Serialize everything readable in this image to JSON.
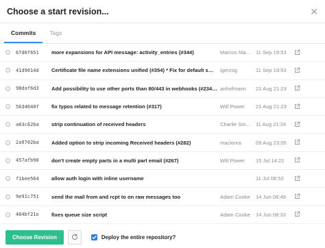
{
  "dialog": {
    "title": "Choose a start revision...",
    "close_glyph": "✕"
  },
  "tabs": [
    {
      "label": "Commits",
      "active": true
    },
    {
      "label": "Tags",
      "active": false
    }
  ],
  "commits": [
    {
      "sha": "67d0f651",
      "message": "more expansions for API message: activity_entries (#344)",
      "author": "Marcos Ma...",
      "date": "11 Sep 19:53"
    },
    {
      "sha": "41d9014d",
      "message": "Certificate file name extensions unified (#354) * Fix for default smtp certifi...",
      "author": "igerzog",
      "date": "11 Sep 19:53"
    },
    {
      "sha": "98daf6d3",
      "message": "Add possibility to use other ports than 80/443 in webhooks (#234) * Adde...",
      "author": "anhofmann",
      "date": "21 Aug 21:23"
    },
    {
      "sha": "5634640f",
      "message": "fix typos related to message retention (#317)",
      "author": "Will Power",
      "date": "21 Aug 21:23"
    },
    {
      "sha": "a63c62ba",
      "message": "strip continuation of received headers",
      "author": "Charlie Sm...",
      "date": "11 Aug 21:24"
    },
    {
      "sha": "2a9702ba",
      "message": "Added option to strip incoming Received headers (#282)",
      "author": "mackinra",
      "date": "09 Aug 23:05"
    },
    {
      "sha": "457afb90",
      "message": "don't create empty parts in a multi part email (#267)",
      "author": "Will Power",
      "date": "15 Jul 14:22"
    },
    {
      "sha": "f1bee564",
      "message": "allow auth login with inline username",
      "author": "",
      "date": "11 Jul 08:52"
    },
    {
      "sha": "9e91c751",
      "message": "send the mail from and rcpt to on raw messages too",
      "author": "Adam Cooke",
      "date": "14 Jun 08:49"
    },
    {
      "sha": "464bf21e",
      "message": "fixes queue size script",
      "author": "Adam Cooke",
      "date": "14 Jun 08:33"
    }
  ],
  "footer": {
    "choose_label": "Choose Revision",
    "deploy_label": "Deploy the entire repository?",
    "deploy_checked": true
  },
  "icons": {
    "external_link": "external-link-icon",
    "refresh": "refresh-icon",
    "check": "check-icon"
  },
  "colors": {
    "primary_button": "#2fbf8c",
    "tab_active": "#3a8be8",
    "checkbox": "#2f7de1"
  }
}
